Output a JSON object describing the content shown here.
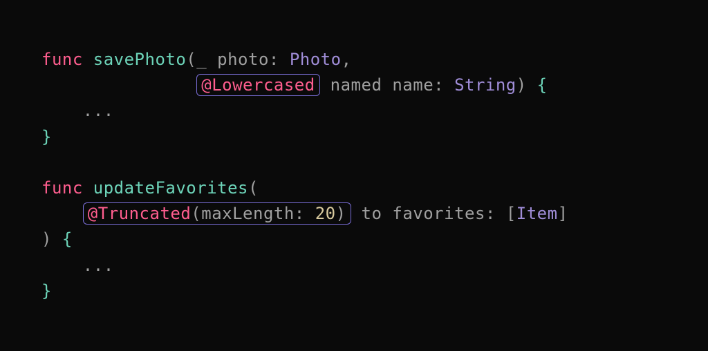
{
  "code": {
    "func1": {
      "keyword": "func",
      "name": "savePhoto",
      "param1_label": "_",
      "param1_name": "photo",
      "param1_type": "Photo",
      "attr": "@Lowercased",
      "param2_label": "named",
      "param2_name": "name",
      "param2_type": "String",
      "body": "...",
      "open": "{",
      "close": "}",
      "lparen": "(",
      "rparen": ")",
      "comma": ",",
      "colon": ":"
    },
    "func2": {
      "keyword": "func",
      "name": "updateFavorites",
      "attr_name": "@Truncated",
      "attr_arg_label": "maxLength",
      "attr_arg_value": "20",
      "param_label": "to",
      "param_name": "favorites",
      "param_type": "Item",
      "body": "...",
      "open": "{",
      "close": "}",
      "lparen": "(",
      "rparen": ")",
      "lbracket": "[",
      "rbracket": "]",
      "colon": ":"
    }
  }
}
